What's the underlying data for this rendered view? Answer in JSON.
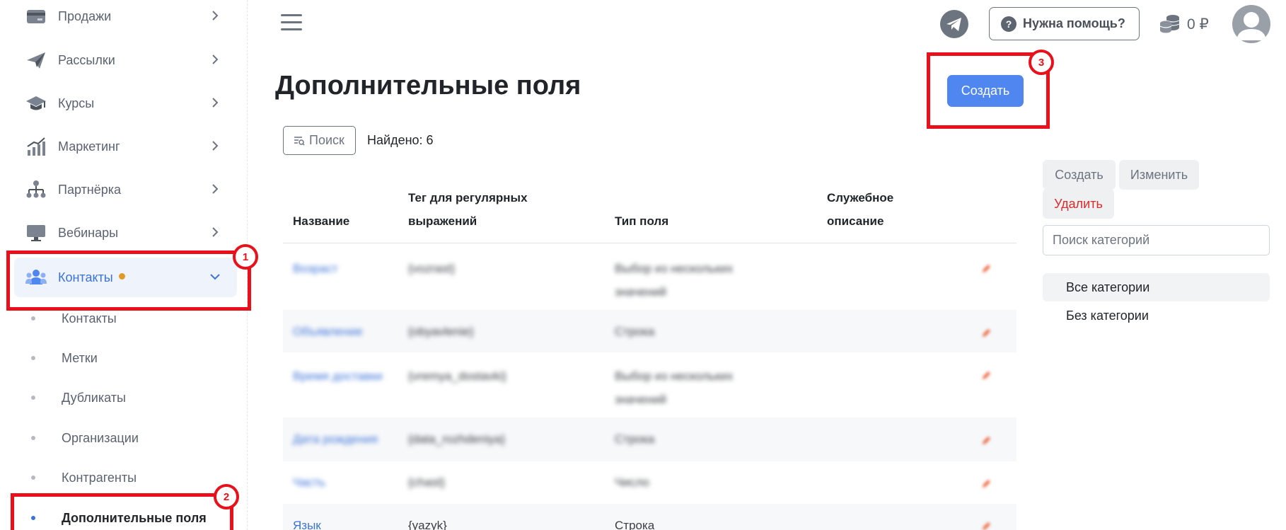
{
  "sidebar": {
    "items": [
      {
        "label": "Продажи",
        "icon": "credit-card-icon"
      },
      {
        "label": "Рассылки",
        "icon": "paper-plane-icon"
      },
      {
        "label": "Курсы",
        "icon": "graduation-cap-icon"
      },
      {
        "label": "Маркетинг",
        "icon": "growth-chart-icon"
      },
      {
        "label": "Партнёрка",
        "icon": "network-icon"
      },
      {
        "label": "Вебинары",
        "icon": "monitor-icon"
      },
      {
        "label": "Контакты",
        "icon": "users-icon"
      }
    ],
    "subitems": [
      "Контакты",
      "Метки",
      "Дубликаты",
      "Организации",
      "Контрагенты",
      "Дополнительные поля"
    ]
  },
  "annotations": [
    "1",
    "2",
    "3"
  ],
  "topbar": {
    "help_label": "Нужна помощь?",
    "help_icon_glyph": "?",
    "balance": "0 ₽"
  },
  "page": {
    "title": "Дополнительные поля",
    "create_label": "Создать",
    "search_label": "Поиск",
    "found_label": "Найдено: 6"
  },
  "table": {
    "headers": {
      "name": "Название",
      "tag_line1": "Тег для регулярных",
      "tag_line2": "выражений",
      "type": "Тип поля",
      "desc_line1": "Служебное",
      "desc_line2": "описание"
    },
    "rows": [
      {
        "name": "Возраст",
        "tag": "{vozrast}",
        "type": [
          "Выбор из нескольких",
          "значений"
        ]
      },
      {
        "name": "Объявление",
        "tag": "{obyavlenie}",
        "type": [
          "Строка"
        ]
      },
      {
        "name": "Время доставки",
        "tag": "{vremya_dostavki}",
        "type": [
          "Выбор из нескольких",
          "значений"
        ]
      },
      {
        "name": "Дата рождения",
        "tag": "{data_rozhdeniya}",
        "type": [
          "Строка"
        ]
      },
      {
        "name": "Часть",
        "tag": "{chast}",
        "type": [
          "Число"
        ]
      },
      {
        "name": "Язык",
        "tag": "{yazyk}",
        "type": [
          "Строка"
        ]
      }
    ]
  },
  "right_panel": {
    "create_label": "Создать",
    "edit_label": "Изменить",
    "delete_label": "Удалить",
    "search_placeholder": "Поиск категорий",
    "categories": [
      "Все категории",
      "Без категории"
    ]
  },
  "colors": {
    "accent": "#4f86f0",
    "highlight": "#e8111b",
    "danger": "#d92b2b"
  }
}
